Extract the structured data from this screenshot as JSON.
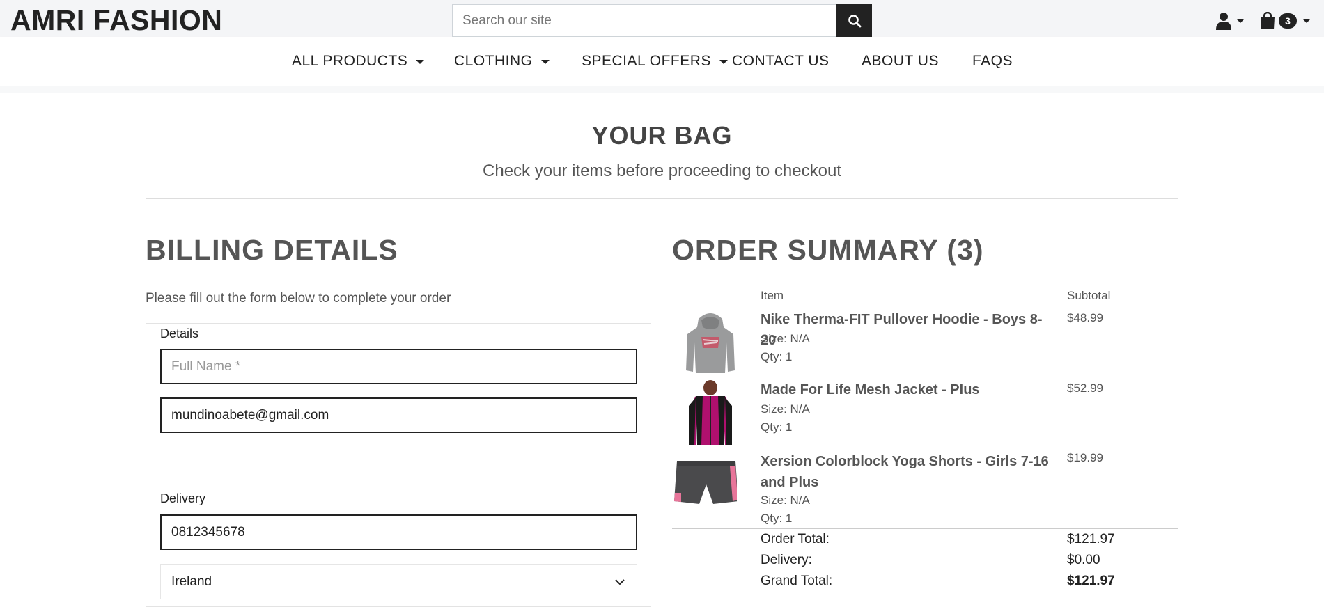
{
  "header": {
    "logo_primary": "AMRI",
    "logo_secondary": "FASHION",
    "search_placeholder": "Search our site",
    "bag_count": "3"
  },
  "nav": {
    "items": [
      {
        "label": "ALL PRODUCTS",
        "dropdown": true
      },
      {
        "label": "CLOTHING",
        "dropdown": true
      },
      {
        "label": "SPECIAL OFFERS",
        "dropdown": true
      },
      {
        "label": "CONTACT US",
        "dropdown": false
      },
      {
        "label": "ABOUT US",
        "dropdown": false
      },
      {
        "label": "FAQS",
        "dropdown": false
      }
    ]
  },
  "page": {
    "title": "YOUR BAG",
    "subtitle": "Check your items before proceeding to checkout"
  },
  "billing": {
    "title": "BILLING DETAILS",
    "intro": "Please fill out the form below to complete your order",
    "details_legend": "Details",
    "full_name_placeholder": "Full Name *",
    "email_value": "mundinoabete@gmail.com",
    "delivery_legend": "Delivery",
    "phone_value": "0812345678",
    "country_value": "Ireland"
  },
  "summary": {
    "title": "ORDER SUMMARY (3)",
    "col_item": "Item",
    "col_subtotal": "Subtotal",
    "items": [
      {
        "name": "Nike Therma-FIT Pullover Hoodie - Boys 8-20",
        "size": "Size: N/A",
        "qty": "Qty: 1",
        "price": "$48.99"
      },
      {
        "name": "Made For Life Mesh Jacket - Plus",
        "size": "Size: N/A",
        "qty": "Qty: 1",
        "price": "$52.99"
      },
      {
        "name": "Xersion Colorblock Yoga Shorts - Girls 7-16 and Plus",
        "size": "Size: N/A",
        "qty": "Qty: 1",
        "price": "$19.99"
      }
    ],
    "order_total_label": "Order Total:",
    "order_total": "$121.97",
    "delivery_label": "Delivery:",
    "delivery": "$0.00",
    "grand_total_label": "Grand Total:",
    "grand_total": "$121.97"
  },
  "colors": {
    "topbar_bg": "#f4f5f7",
    "dark": "#222222",
    "text": "#555555"
  }
}
